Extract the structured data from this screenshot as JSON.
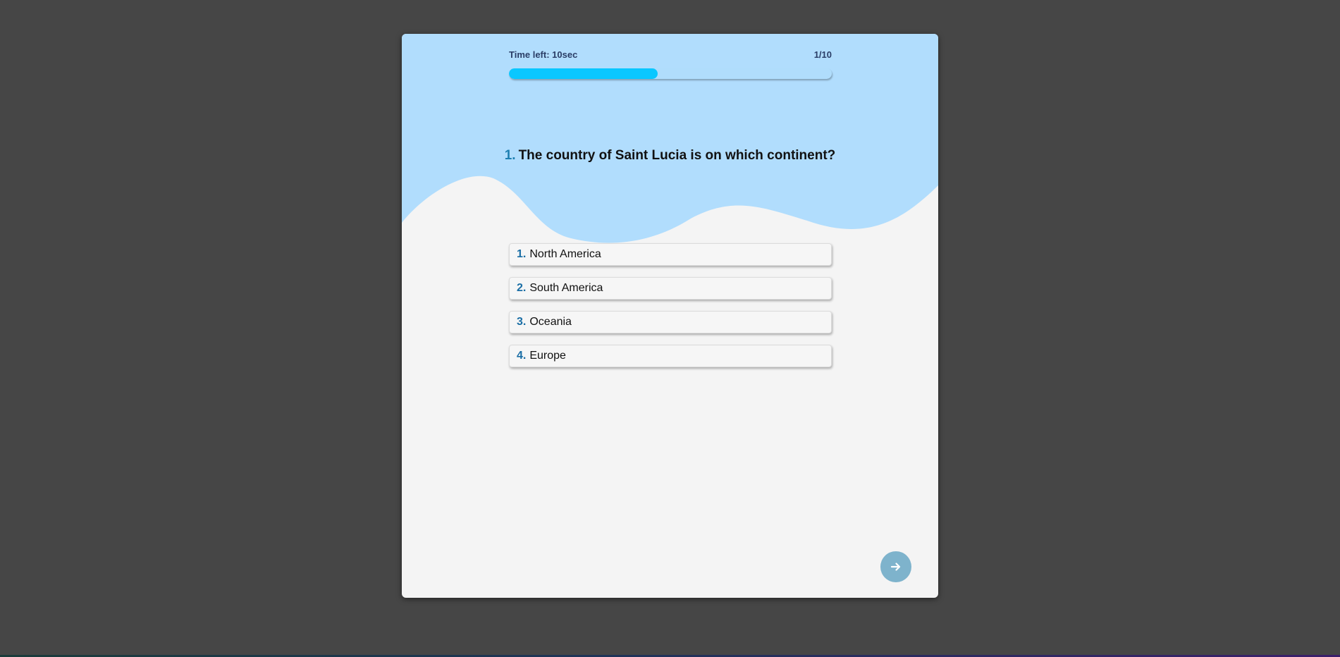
{
  "timer": {
    "label": "Time left: 10sec",
    "progress": 0.46
  },
  "counter": "1/10",
  "question": {
    "number": "1.",
    "text": "The country of Saint Lucia is on which continent?"
  },
  "answers": [
    {
      "number": "1.",
      "text": "North America"
    },
    {
      "number": "2.",
      "text": "South America"
    },
    {
      "number": "3.",
      "text": "Oceania"
    },
    {
      "number": "4.",
      "text": "Europe"
    }
  ],
  "next_button": {
    "icon": "arrow-right-icon"
  },
  "colors": {
    "page_bg": "#464646",
    "card_bg": "#f4f4f4",
    "wave": "#b1ddfd",
    "progress_fill": "#0ac7ff",
    "accent_number": "#1a6ea5",
    "next_button": "#7eb3cc"
  }
}
